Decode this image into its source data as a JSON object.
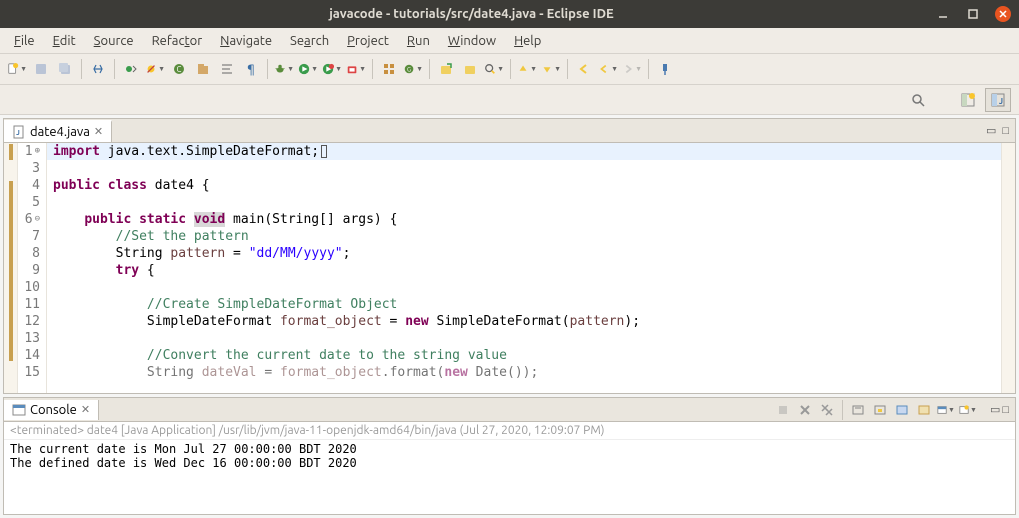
{
  "window": {
    "title": "javacode - tutorials/src/date4.java - Eclipse IDE"
  },
  "menu": {
    "file": "File",
    "edit": "Edit",
    "source": "Source",
    "refactor": "Refactor",
    "navigate": "Navigate",
    "search": "Search",
    "project": "Project",
    "run": "Run",
    "window": "Window",
    "help": "Help"
  },
  "editor": {
    "tab_name": "date4.java",
    "lines": {
      "l1_import": "import",
      "l1_rest": " java.text.SimpleDateFormat;",
      "l3": "",
      "l4_public": "public",
      "l4_class": "class",
      "l4_rest": " date4 {",
      "l5": "",
      "l6_public": "public",
      "l6_static": "static",
      "l6_void": "void",
      "l6_rest": " main(String[] args) {",
      "l7_cm": "//Set the pattern",
      "l8_a": "String ",
      "l8_var": "pattern",
      "l8_b": " = ",
      "l8_str": "\"dd/MM/yyyy\"",
      "l8_c": ";",
      "l9_try": "try",
      "l9_rest": " {",
      "l10": "",
      "l11_cm": "//Create SimpleDateFormat Object",
      "l12_a": "SimpleDateFormat ",
      "l12_var": "format_object",
      "l12_b": " = ",
      "l12_new": "new",
      "l12_c": " SimpleDateFormat(",
      "l12_arg": "pattern",
      "l12_d": ");",
      "l13": "",
      "l14_cm": "//Convert the current date to the string value",
      "l15_a": "String ",
      "l15_var": "dateVal",
      "l15_b": " = ",
      "l15_obj": "format_object",
      "l15_c": ".format(",
      "l15_new": "new",
      "l15_d": " Date());"
    },
    "line_numbers": [
      "1",
      "3",
      "4",
      "5",
      "6",
      "7",
      "8",
      "9",
      "10",
      "11",
      "12",
      "13",
      "14",
      "15"
    ]
  },
  "console": {
    "tab_name": "Console",
    "status": "<terminated> date4 [Java Application] /usr/lib/jvm/java-11-openjdk-amd64/bin/java (Jul 27, 2020, 12:09:07 PM)",
    "out1": "The current date is Mon Jul 27 00:00:00 BDT 2020",
    "out2": "The defined date is Wed Dec 16 00:00:00 BDT 2020"
  }
}
